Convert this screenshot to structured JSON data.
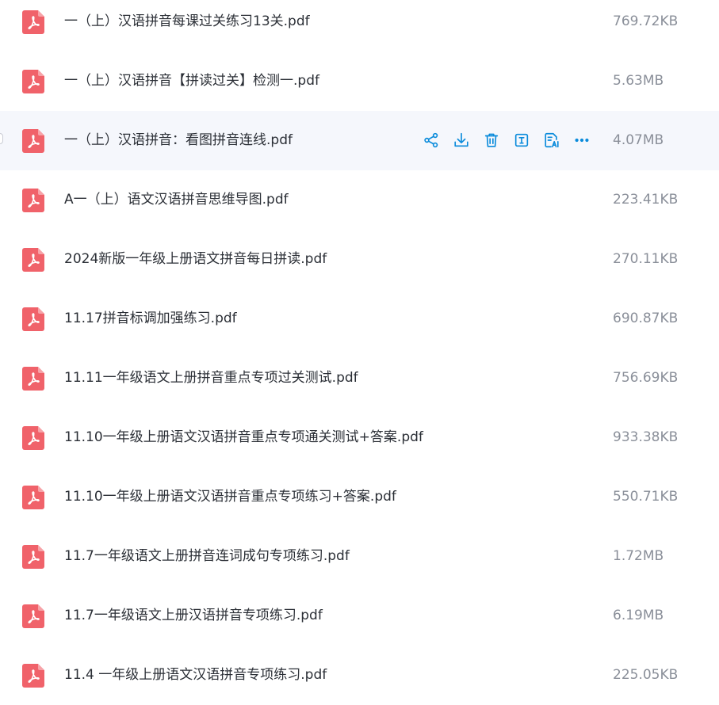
{
  "files": [
    {
      "name": "一（上）汉语拼音每课过关练习13关.pdf",
      "size": "769.72KB",
      "icon": "pdf-icon"
    },
    {
      "name": "一（上）汉语拼音【拼读过关】检测一.pdf",
      "size": "5.63MB",
      "icon": "pdf-icon"
    },
    {
      "name": "一（上）汉语拼音：看图拼音连线.pdf",
      "size": "4.07MB",
      "icon": "pdf-icon",
      "hovered": true
    },
    {
      "name": "A一（上）语文汉语拼音思维导图.pdf",
      "size": "223.41KB",
      "icon": "pdf-icon"
    },
    {
      "name": "2024新版一年级上册语文拼音每日拼读.pdf",
      "size": "270.11KB",
      "icon": "pdf-icon"
    },
    {
      "name": "11.17拼音标调加强练习.pdf",
      "size": "690.87KB",
      "icon": "pdf-icon"
    },
    {
      "name": "11.11一年级语文上册拼音重点专项过关测试.pdf",
      "size": "756.69KB",
      "icon": "pdf-icon"
    },
    {
      "name": "11.10一年级上册语文汉语拼音重点专项通关测试+答案.pdf",
      "size": "933.38KB",
      "icon": "pdf-icon"
    },
    {
      "name": "11.10一年级上册语文汉语拼音重点专项练习+答案.pdf",
      "size": "550.71KB",
      "icon": "pdf-icon"
    },
    {
      "name": "11.7一年级语文上册拼音连词成句专项练习.pdf",
      "size": "1.72MB",
      "icon": "pdf-icon"
    },
    {
      "name": "11.7一年级语文上册汉语拼音专项练习.pdf",
      "size": "6.19MB",
      "icon": "pdf-icon"
    },
    {
      "name": "11.4 一年级上册语文汉语拼音专项练习.pdf",
      "size": "225.05KB",
      "icon": "pdf-icon"
    }
  ],
  "row_actions": [
    {
      "name": "share",
      "icon": "share-icon"
    },
    {
      "name": "download",
      "icon": "download-icon"
    },
    {
      "name": "delete",
      "icon": "trash-icon"
    },
    {
      "name": "text-extract",
      "icon": "text-icon"
    },
    {
      "name": "ai-read",
      "icon": "ai-document-icon"
    },
    {
      "name": "more",
      "icon": "more-icon"
    }
  ],
  "colors": {
    "accent": "#0a8bdb",
    "pdf_icon": "#f0626a",
    "hover_bg": "#f5f7fc",
    "text": "#2b2f36",
    "muted": "#8a8f99"
  }
}
